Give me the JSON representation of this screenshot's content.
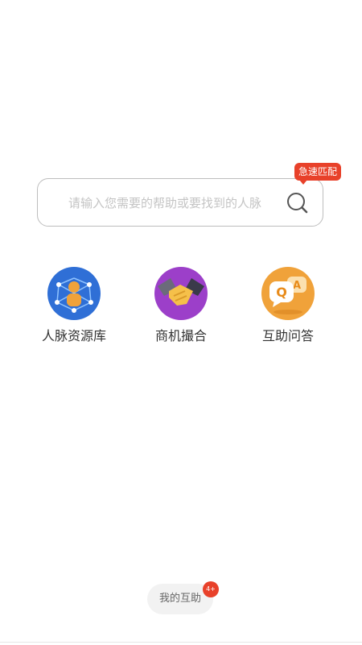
{
  "search": {
    "placeholder": "请输入您需要的帮助或要找到的人脉",
    "badge": "急速匹配"
  },
  "features": [
    {
      "label": "人脉资源库",
      "icon": "network-people-icon"
    },
    {
      "label": "商机撮合",
      "icon": "handshake-icon"
    },
    {
      "label": "互助问答",
      "icon": "qa-bubbles-icon"
    }
  ],
  "my_help": {
    "label": "我的互助",
    "badge": "4+"
  },
  "colors": {
    "accent_red": "#e8412a",
    "network_blue": "#2f6fd6",
    "handshake_purple": "#9c3fc9",
    "qa_orange": "#f0a23a"
  }
}
